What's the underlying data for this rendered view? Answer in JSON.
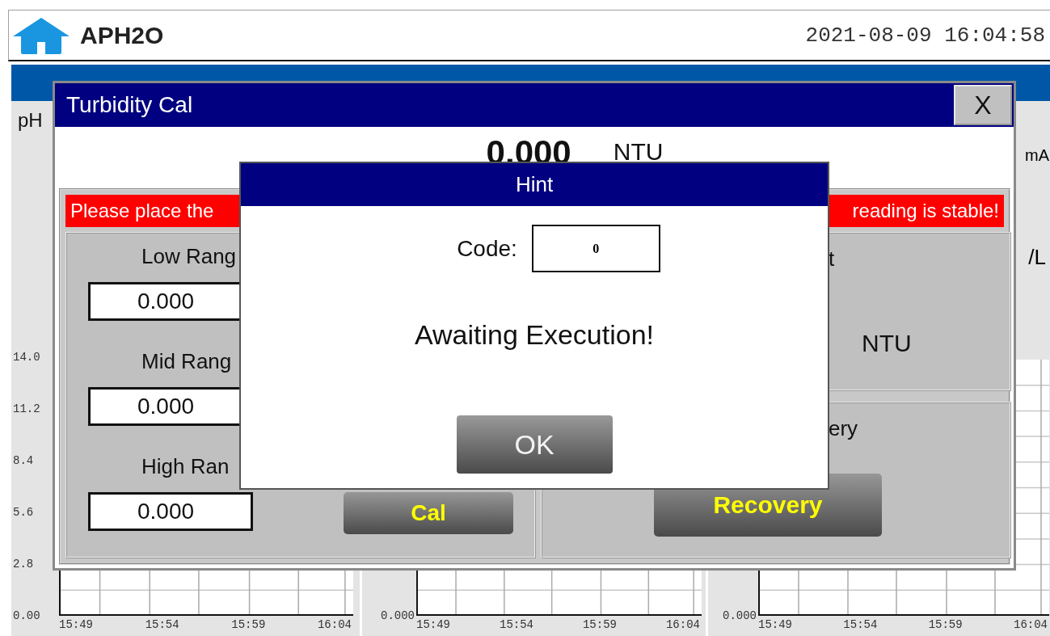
{
  "header": {
    "title": "APH2O",
    "datetime": "2021-08-09 16:04:58"
  },
  "panels": [
    {
      "label": "pH",
      "y_ticks": [
        "14.0",
        "11.2",
        "8.4",
        "5.6",
        "2.8",
        "0.00"
      ],
      "x_ticks": [
        "15:49",
        "15:54",
        "15:59",
        "16:04"
      ]
    },
    {
      "y_ticks": [
        "0.000"
      ],
      "x_ticks": [
        "15:49",
        "15:54",
        "15:59",
        "16:04"
      ]
    },
    {
      "top_label": "mA",
      "unit_label": "/L",
      "y_ticks": [
        "0.000"
      ],
      "x_ticks": [
        "15:49",
        "15:54",
        "15:59",
        "16:04"
      ]
    }
  ],
  "cal_dialog": {
    "title": "Turbidity Cal",
    "close": "X",
    "reading": "0.000",
    "unit": "NTU",
    "banner": [
      "Please place the",
      "reading is stable!"
    ],
    "ranges": [
      {
        "label": "Low Rang",
        "value": "0.000"
      },
      {
        "label": "Mid Rang",
        "value": "0.000"
      },
      {
        "label": "High Ran",
        "value": "0.000"
      }
    ],
    "cal_button": "Cal",
    "current": {
      "label": "t",
      "unit": "NTU"
    },
    "recovery": {
      "label": "ery",
      "button": "Recovery"
    }
  },
  "hint_dialog": {
    "title": "Hint",
    "code_label": "Code:",
    "code": "0",
    "message": "Awaiting Execution!",
    "ok": "OK"
  }
}
